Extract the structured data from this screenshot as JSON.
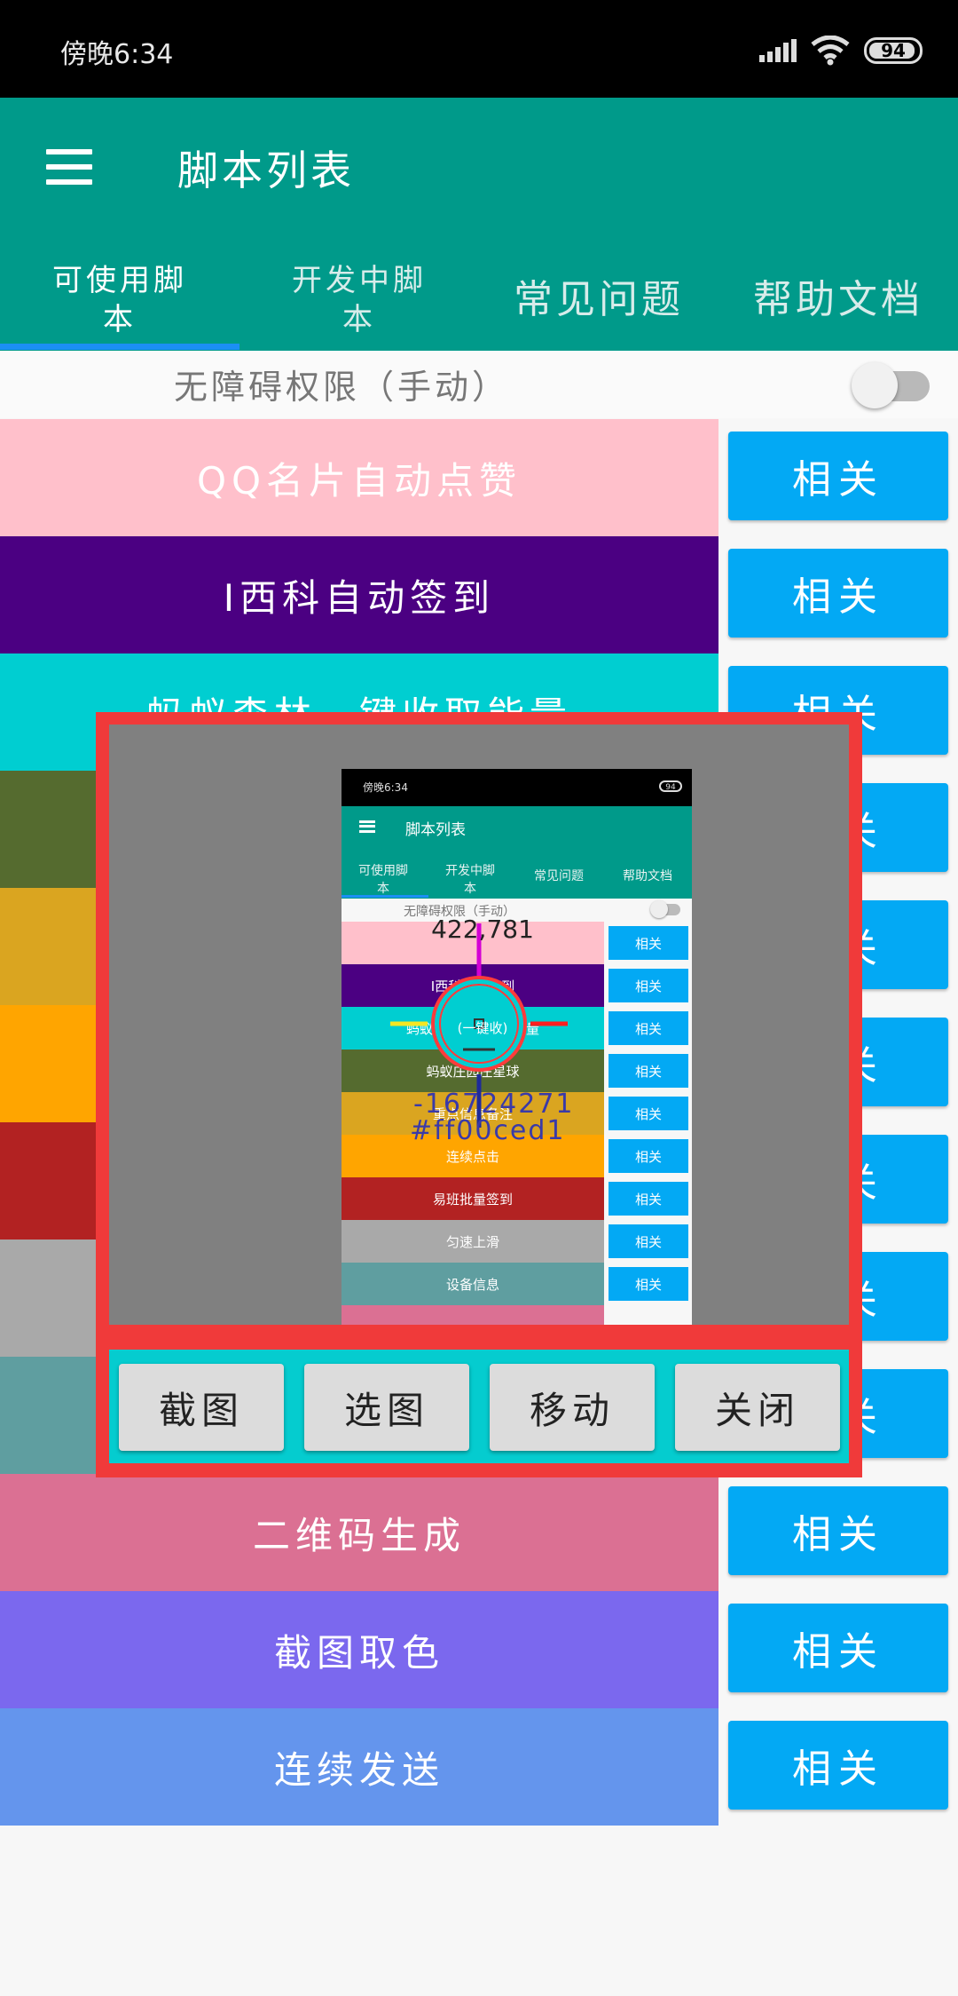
{
  "status": {
    "time": "傍晚6:34",
    "battery": "94",
    "battery_level": 0.94
  },
  "appbar": {
    "title": "脚本列表"
  },
  "tabs": [
    {
      "label": "可使用脚\n本",
      "active": true
    },
    {
      "label": "开发中脚\n本",
      "active": false
    },
    {
      "label": "常见问题",
      "active": false
    },
    {
      "label": "帮助文档",
      "active": false
    }
  ],
  "accessibility": {
    "label": "无障碍权限（手动）",
    "enabled": false
  },
  "rows": [
    {
      "label": "QQ名片自动点赞",
      "color": "#ffc0cb"
    },
    {
      "label": "I西科自动签到",
      "color": "#4b0082"
    },
    {
      "label": "蚂蚁森林一键收取能量",
      "color": "#00ced1"
    },
    {
      "label": "",
      "color": "#556b2f"
    },
    {
      "label": "",
      "color": "#daa520"
    },
    {
      "label": "",
      "color": "#ffa500"
    },
    {
      "label": "",
      "color": "#b22222"
    },
    {
      "label": "",
      "color": "#a9a9a9"
    },
    {
      "label": "",
      "color": "#5f9ea0"
    },
    {
      "label": "二维码生成",
      "color": "#db7093"
    },
    {
      "label": "截图取色",
      "color": "#7b68ee"
    },
    {
      "label": "连续发送",
      "color": "#6495ed"
    }
  ],
  "related_label": "相关",
  "overlay": {
    "buttons": [
      "截图",
      "选图",
      "移动",
      "关闭"
    ],
    "preview": {
      "time": "傍晚6:34",
      "battery": "94",
      "title": "脚本列表",
      "tabs": [
        "可使用脚\n本",
        "开发中脚\n本",
        "常见问题",
        "帮助文档"
      ],
      "a11y": "无障碍权限（手动）",
      "rows": [
        {
          "label": "",
          "color": "#ffc0cb"
        },
        {
          "label": "I西科自动签到",
          "color": "#4b0082"
        },
        {
          "label": "蚂蚁森林一键收取能量",
          "color": "#00ced1"
        },
        {
          "label": "蚂蚁庄园庄星球",
          "color": "#556b2f"
        },
        {
          "label": "重点信息备注",
          "color": "#daa520"
        },
        {
          "label": "连续点击",
          "color": "#ffa500"
        },
        {
          "label": "易班批量签到",
          "color": "#b22222"
        },
        {
          "label": "匀速上滑",
          "color": "#a9a9a9"
        },
        {
          "label": "设备信息",
          "color": "#5f9ea0"
        }
      ],
      "coords": "422,781",
      "color_int": "-16724271",
      "color_hex": "#ff00ced1",
      "magnifier_text": "(一键收)"
    }
  }
}
